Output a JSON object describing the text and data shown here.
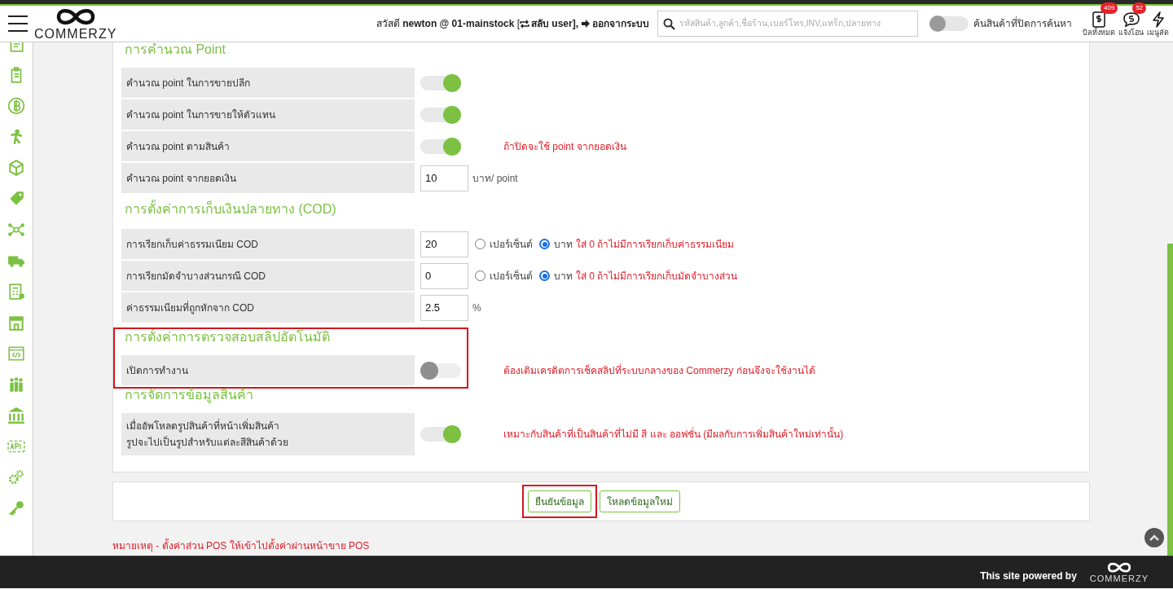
{
  "header": {
    "logo": "COMMERZY",
    "greeting": "สวัสดี **newton @ 01-mainstock** [",
    "switch_user": "สลับ user],",
    "logout": "ออกจากระบบ",
    "search": {
      "placeholder": "รหัสสินค้า,ลูกค้า,ชื่อร้าน,เบอร์โทร,INV,แทร็ก,ปลายทาง"
    },
    "hidden_search_toggle": {
      "on": false,
      "label": "ค้นสินค้าที่ปิดการค้นหา"
    },
    "shortcuts": [
      {
        "kind": "bill",
        "label": "บิลทั้งหมด",
        "badge": "409"
      },
      {
        "kind": "chat",
        "label": "แจ้งโอน",
        "badge": "52"
      },
      {
        "kind": "bolt",
        "label": "เมนูลัด"
      }
    ]
  },
  "sections": [
    {
      "title": "การคำนวณ Point",
      "highlighted": false,
      "rows": [
        {
          "kind": "toggle",
          "label": "คำนวณ point ในการขายปลีก",
          "on": true
        },
        {
          "kind": "toggle",
          "label": "คำนวณ point ในการขายให้ตัวแทน",
          "on": true
        },
        {
          "kind": "toggle",
          "label": "คำนวณ point ตามสินค้า",
          "on": true,
          "note": "ถ้าปิดจะใช้ point จากยอดเงิน"
        },
        {
          "kind": "number",
          "label": "คำนวณ point จากยอดเงิน",
          "value": "10",
          "unit": "บาท/ point"
        }
      ]
    },
    {
      "title": "การตั้งค่าการเก็บเงินปลายทาง (COD)",
      "highlighted": false,
      "rows": [
        {
          "kind": "number_radio",
          "label": "การเรียกเก็บค่าธรรมเนียม COD",
          "value": "20",
          "options": [
            {
              "label": "เปอร์เซ็นต์",
              "selected": false
            },
            {
              "label": "บาท",
              "selected": true
            }
          ],
          "note": "ใส่ 0 ถ้าไม่มีการเรียกเก็บค่าธรรมเนียม"
        },
        {
          "kind": "number_radio",
          "label": "การเรียกมัดจำบางส่วนกรณี COD",
          "value": "0",
          "options": [
            {
              "label": "เปอร์เซ็นต์",
              "selected": false
            },
            {
              "label": "บาท",
              "selected": true
            }
          ],
          "note": "ใส่ 0 ถ้าไม่มีการเรียกเก็บมัดจำบางส่วน"
        },
        {
          "kind": "number",
          "label": "ค่าธรรมเนียมที่ถูกหักจาก COD",
          "value": "2.5",
          "unit": "%"
        }
      ]
    },
    {
      "title": "การตั้งค่าการตรวจสอบสลิปอัตโนมัติ",
      "highlighted": true,
      "rows": [
        {
          "kind": "toggle",
          "label": "เปิดการทำงาน",
          "on": false,
          "note": "ต้องเติมเครดิตการเช็คสลิปที่ระบบกลางของ Commerzy ก่อนจึงจะใช้งานได้"
        }
      ]
    },
    {
      "title": "การจัดการข้อมูลสินค้า",
      "highlighted": false,
      "rows": [
        {
          "kind": "toggle",
          "label": "เมื่ออัพโหลดรูปสินค้าที่หน้าเพิ่มสินค้า\nรูปจะไปเป็นรูปสำหรับแต่ละสีสินค้าด้วย",
          "on": true,
          "note": "เหมาะกับสินค้าที่เป็นสินค้าที่ไม่มี สี และ ออฟชั่น (มีผลกับการเพิ่มสินค้าใหม่เท่านั้น)"
        }
      ]
    }
  ],
  "buttons": [
    {
      "label": "ยืนยันข้อมูล",
      "highlighted": true
    },
    {
      "label": "โหลดข้อมูลใหม่",
      "highlighted": false
    }
  ],
  "footnote": "หมายเหตุ - ตั้งค่าส่วน POS ให้เข้าไปตั้งค่าผ่านหน้าขาย POS",
  "footer": {
    "text": "This site powered by",
    "logo": "COMMERZY"
  }
}
